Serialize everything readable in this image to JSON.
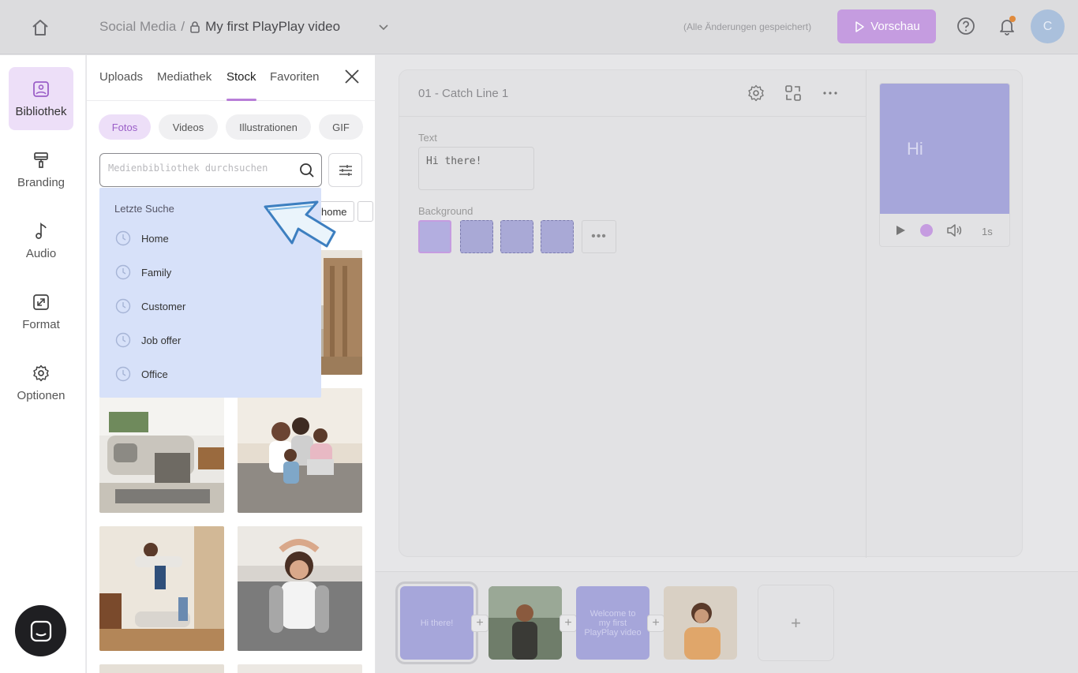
{
  "header": {
    "breadcrumb_parent": "Social Media",
    "breadcrumb_separator": "/",
    "project_title": "My first PlayPlay video",
    "save_status": "(Alle Änderungen gespeichert)",
    "preview_label": "Vorschau",
    "avatar_initial": "C",
    "accent_color": "#c59ce0"
  },
  "rail": {
    "items": [
      {
        "label": "Bibliothek",
        "icon": "image-icon",
        "active": true
      },
      {
        "label": "Branding",
        "icon": "brush-icon"
      },
      {
        "label": "Audio",
        "icon": "music-note-icon"
      },
      {
        "label": "Format",
        "icon": "resize-icon"
      },
      {
        "label": "Optionen",
        "icon": "gear-icon"
      }
    ]
  },
  "library": {
    "tabs": [
      "Uploads",
      "Mediathek",
      "Stock",
      "Favoriten"
    ],
    "active_tab": "Stock",
    "chips": [
      "Fotos",
      "Videos",
      "Illustrationen",
      "GIF"
    ],
    "active_chip": "Fotos",
    "search_placeholder": "Medienbibliothek durchsuchen",
    "tag_suggestion": "home",
    "recent_search": {
      "heading": "Letzte Suche",
      "items": [
        "Home",
        "Family",
        "Customer",
        "Job offer",
        "Office"
      ]
    }
  },
  "editor": {
    "slide_name": "01 - Catch Line 1",
    "text_label": "Text",
    "text_value": "Hi there!",
    "background_label": "Background",
    "more_label": "•••",
    "preview_text": "Hi",
    "duration": "1s"
  },
  "timeline": {
    "slides": [
      {
        "label": "Hi there!",
        "kind": "text"
      },
      {
        "label": "",
        "kind": "photo"
      },
      {
        "label": "Welcome to my first PlayPlay video",
        "kind": "text"
      },
      {
        "label": "",
        "kind": "photo"
      }
    ],
    "add_label": "+"
  }
}
